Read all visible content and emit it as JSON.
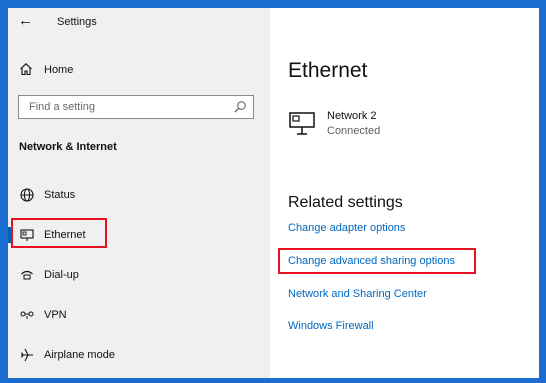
{
  "window": {
    "title": "Settings"
  },
  "sidebar": {
    "home_label": "Home",
    "search_placeholder": "Find a setting",
    "section_heading": "Network & Internet",
    "items": [
      {
        "label": "Status",
        "icon": "globe-status-icon"
      },
      {
        "label": "Ethernet",
        "icon": "ethernet-icon",
        "selected": true
      },
      {
        "label": "Dial-up",
        "icon": "dialup-phone-icon"
      },
      {
        "label": "VPN",
        "icon": "vpn-icon"
      },
      {
        "label": "Airplane mode",
        "icon": "airplane-icon"
      }
    ]
  },
  "main": {
    "title": "Ethernet",
    "network": {
      "name": "Network 2",
      "status": "Connected",
      "icon": "network-monitor-icon"
    },
    "related_heading": "Related settings",
    "links": [
      "Change adapter options",
      "Change advanced sharing options",
      "Network and Sharing Center",
      "Windows Firewall"
    ]
  },
  "colors": {
    "accent": "#0063b1",
    "link": "#0067c0",
    "highlight": "#e81123",
    "sidebar_bg": "#f0f0f0",
    "frame": "#1b6cd0"
  }
}
